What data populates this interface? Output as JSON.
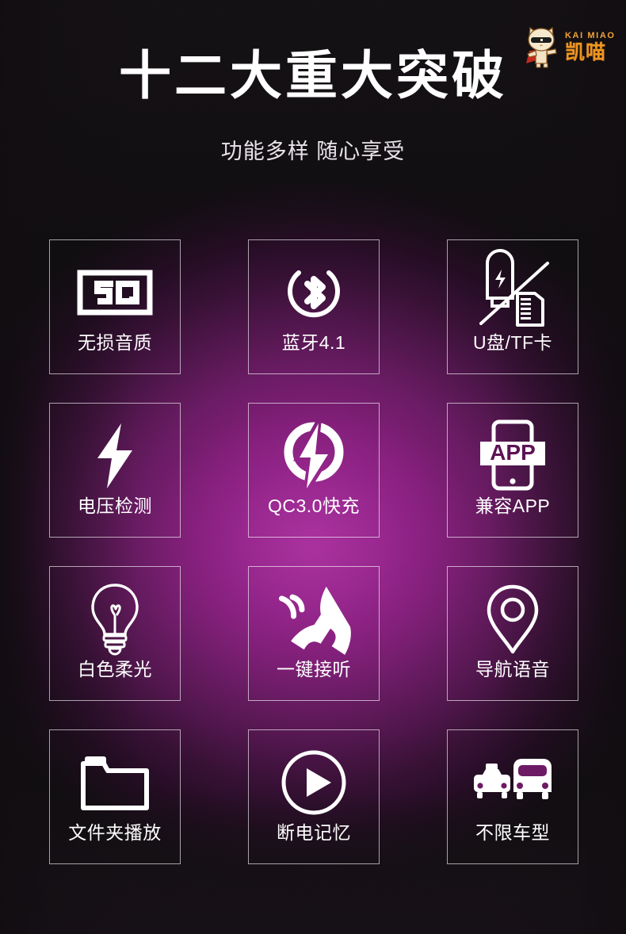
{
  "poster": {
    "title": "十二大重大突破",
    "subtitle": "功能多样 随心享受",
    "background_start_color": "#141114",
    "background_glow_color": "#9b2a90",
    "accent_color": "#f0941f",
    "cell_border_color": "#ffffff"
  },
  "logo": {
    "latin_text": "KAI MIAO",
    "chinese_text": "凯喵",
    "mascot_icon": "cat-mascot-icon",
    "color": "#f0941f"
  },
  "features": [
    {
      "icon": "sq-lossless-badge-icon",
      "badge_text": "SQ",
      "label": "无损音质"
    },
    {
      "icon": "bluetooth-icon",
      "badge_text": "",
      "label": "蓝牙4.1"
    },
    {
      "icon": "usb-drive-tf-card-icon",
      "badge_text": "",
      "label": "U盘/TF卡"
    },
    {
      "icon": "lightning-bolt-icon",
      "badge_text": "",
      "label": "电压检测"
    },
    {
      "icon": "quick-charge-icon",
      "badge_text": "",
      "label": "QC3.0快充"
    },
    {
      "icon": "app-phone-icon",
      "badge_text": "APP",
      "label": "兼容APP"
    },
    {
      "icon": "light-bulb-icon",
      "badge_text": "",
      "label": "白色柔光"
    },
    {
      "icon": "phone-call-icon",
      "badge_text": "",
      "label": "一键接听"
    },
    {
      "icon": "map-pin-icon",
      "badge_text": "",
      "label": "导航语音"
    },
    {
      "icon": "folder-icon",
      "badge_text": "",
      "label": "文件夹播放"
    },
    {
      "icon": "play-circle-icon",
      "badge_text": "",
      "label": "断电记忆"
    },
    {
      "icon": "car-bus-icon",
      "badge_text": "",
      "label": "不限车型"
    }
  ]
}
